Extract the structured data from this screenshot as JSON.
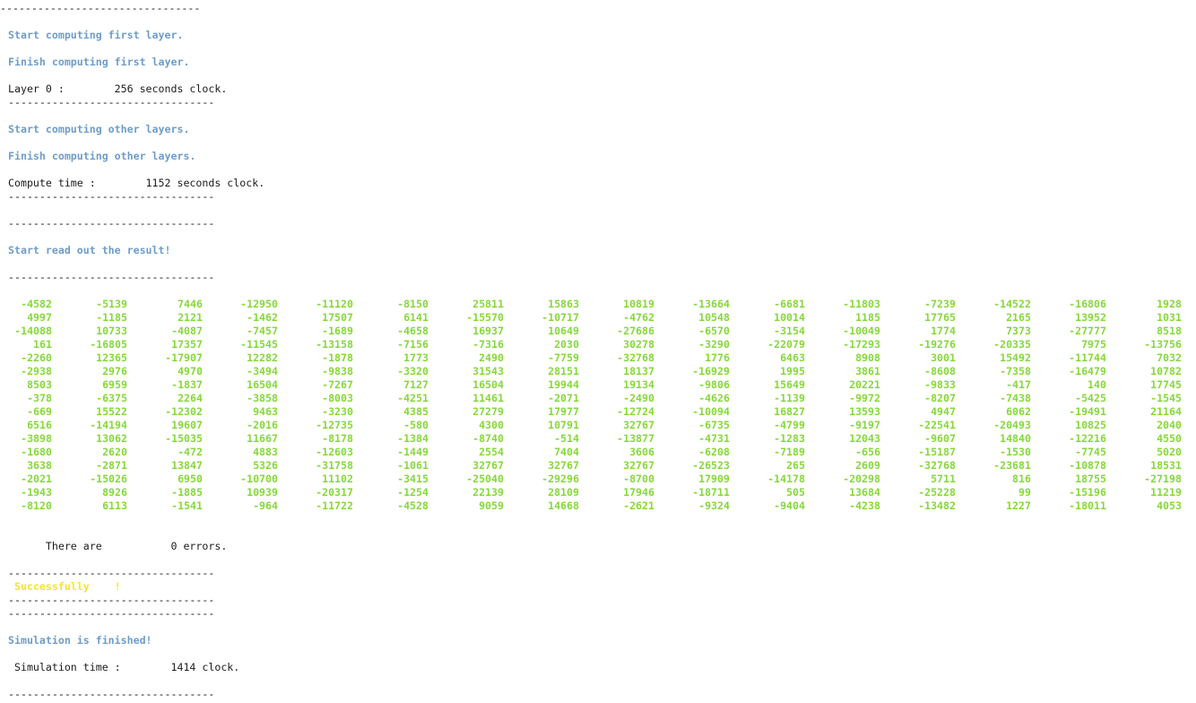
{
  "terminal": {
    "divider": "--------------------------------",
    "divider_long": "---------------------------------",
    "start_first": "Start computing first layer.",
    "finish_first": "Finish computing first layer.",
    "layer0_line": "Layer 0 :        256 seconds clock.",
    "start_other": "Start computing other layers.",
    "finish_other": "Finish computing other layers.",
    "compute_time_line": "Compute time :        1152 seconds clock.",
    "start_read": "Start read out the result!",
    "errors_line": "      There are           0 errors.",
    "success_line": " Successfully    !",
    "sim_finished": "Simulation is finished!",
    "sim_time_line": " Simulation time :        1414 clock."
  },
  "matrix": [
    [
      "-4582",
      "-5139",
      "7446",
      "-12950",
      "-11120",
      "-8150",
      "25811",
      "15863",
      "10819",
      "-13664",
      "-6681",
      "-11803",
      "-7239",
      "-14522",
      "-16806",
      "1928"
    ],
    [
      "4997",
      "-1185",
      "2121",
      "-1462",
      "17507",
      "6141",
      "-15570",
      "-10717",
      "-4762",
      "10548",
      "10014",
      "1185",
      "17765",
      "2165",
      "13952",
      "1031"
    ],
    [
      "-14088",
      "10733",
      "-4087",
      "-7457",
      "-1689",
      "-4658",
      "16937",
      "10649",
      "-27686",
      "-6570",
      "-3154",
      "-10049",
      "1774",
      "7373",
      "-27777",
      "8518"
    ],
    [
      "161",
      "-16805",
      "17357",
      "-11545",
      "-13158",
      "-7156",
      "-7316",
      "2030",
      "30278",
      "-3290",
      "-22079",
      "-17293",
      "-19276",
      "-20335",
      "7975",
      "-13756"
    ],
    [
      "-2260",
      "12365",
      "-17907",
      "12282",
      "-1878",
      "1773",
      "2490",
      "-7759",
      "-32768",
      "1776",
      "6463",
      "8908",
      "3001",
      "15492",
      "-11744",
      "7032"
    ],
    [
      "-2938",
      "2976",
      "4970",
      "-3494",
      "-9838",
      "-3320",
      "31543",
      "28151",
      "18137",
      "-16929",
      "1995",
      "3861",
      "-8608",
      "-7358",
      "-16479",
      "10782"
    ],
    [
      "8503",
      "6959",
      "-1837",
      "16504",
      "-7267",
      "7127",
      "16504",
      "19944",
      "19134",
      "-9806",
      "15649",
      "20221",
      "-9833",
      "-417",
      "140",
      "17745"
    ],
    [
      "-378",
      "-6375",
      "2264",
      "-3858",
      "-8003",
      "-4251",
      "11461",
      "-2071",
      "-2490",
      "-4626",
      "-1139",
      "-9972",
      "-8207",
      "-7438",
      "-5425",
      "-1545"
    ],
    [
      "-669",
      "15522",
      "-12302",
      "9463",
      "-3230",
      "4385",
      "27279",
      "17977",
      "-12724",
      "-10094",
      "16827",
      "13593",
      "4947",
      "6062",
      "-19491",
      "21164"
    ],
    [
      "6516",
      "-14194",
      "19607",
      "-2016",
      "-12735",
      "-580",
      "4300",
      "10791",
      "32767",
      "-6735",
      "-4799",
      "-9197",
      "-22541",
      "-20493",
      "10825",
      "2040"
    ],
    [
      "-3898",
      "13062",
      "-15035",
      "11667",
      "-8178",
      "-1384",
      "-8740",
      "-514",
      "-13877",
      "-4731",
      "-1283",
      "12043",
      "-9607",
      "14840",
      "-12216",
      "4550"
    ],
    [
      "-1680",
      "2620",
      "-472",
      "4883",
      "-12603",
      "-1449",
      "2554",
      "7404",
      "3606",
      "-6208",
      "-7189",
      "-656",
      "-15187",
      "-1530",
      "-7745",
      "5020"
    ],
    [
      "3638",
      "-2871",
      "13847",
      "5326",
      "-31758",
      "-1061",
      "32767",
      "32767",
      "32767",
      "-26523",
      "265",
      "2609",
      "-32768",
      "-23681",
      "-10878",
      "18531"
    ],
    [
      "-2021",
      "-15026",
      "6950",
      "-10700",
      "11102",
      "-3415",
      "-25040",
      "-29296",
      "-8700",
      "17909",
      "-14178",
      "-20298",
      "5711",
      "816",
      "18755",
      "-27198"
    ],
    [
      "-1943",
      "8926",
      "-1885",
      "10939",
      "-20317",
      "-1254",
      "22139",
      "28109",
      "17946",
      "-18711",
      "505",
      "13684",
      "-25228",
      "99",
      "-15196",
      "11219"
    ],
    [
      "-8120",
      "6113",
      "-1541",
      "-964",
      "-11722",
      "-4528",
      "9059",
      "14668",
      "-2621",
      "-9324",
      "-9404",
      "-4238",
      "-13482",
      "1227",
      "-18011",
      "4053"
    ]
  ],
  "colors": {
    "info_text": "#6d9dc8",
    "matrix_values": "#86d83a",
    "success_text": "#f7e330",
    "plain_text": "#1a1a1a",
    "background": "#ffffff"
  }
}
